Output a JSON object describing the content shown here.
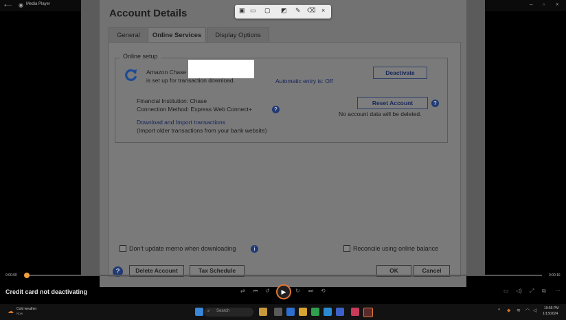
{
  "window": {
    "title": "Media Player"
  },
  "snip_toolbar": {
    "icons": [
      "rectangle-snip-icon",
      "video-record-icon",
      "window-snip-icon",
      "screen-snip-icon",
      "pen-icon",
      "eraser-icon",
      "close-icon"
    ],
    "close_glyph": "×"
  },
  "dialog": {
    "title": "Account Details",
    "tabs": [
      {
        "label": "General",
        "active": false
      },
      {
        "label": "Online Services",
        "active": true
      },
      {
        "label": "Display Options",
        "active": false
      }
    ],
    "online_setup": {
      "legend": "Online setup",
      "account_line1": "Amazon Chase",
      "account_line2": "is set up for transaction download.",
      "automatic_entry": "Automatic entry is: Off",
      "deactivate_label": "Deactivate",
      "institution": "Financial Institution: Chase",
      "connection_method": "Connection Method: Express Web Connect+",
      "reset_label": "Reset Account",
      "reset_note": "No account data will be deleted.",
      "download_link": "Download and Import transactions",
      "download_note": "(Import older transactions from your bank website)"
    },
    "dont_update_memo": "Don't update memo when downloading",
    "reconcile_online": "Reconcile using online balance",
    "delete_account": "Delete Account",
    "tax_schedule": "Tax Schedule",
    "ok": "OK",
    "cancel": "Cancel"
  },
  "player": {
    "elapsed": "0:00:00",
    "total": "0:00:16",
    "caption": "Credit card not deactivating",
    "progress_fraction": 0
  },
  "taskbar": {
    "weather_title": "Cold weather",
    "weather_sub": "Now",
    "search_placeholder": "Search",
    "time": "10:55 PM",
    "date": "1/13/2024"
  }
}
